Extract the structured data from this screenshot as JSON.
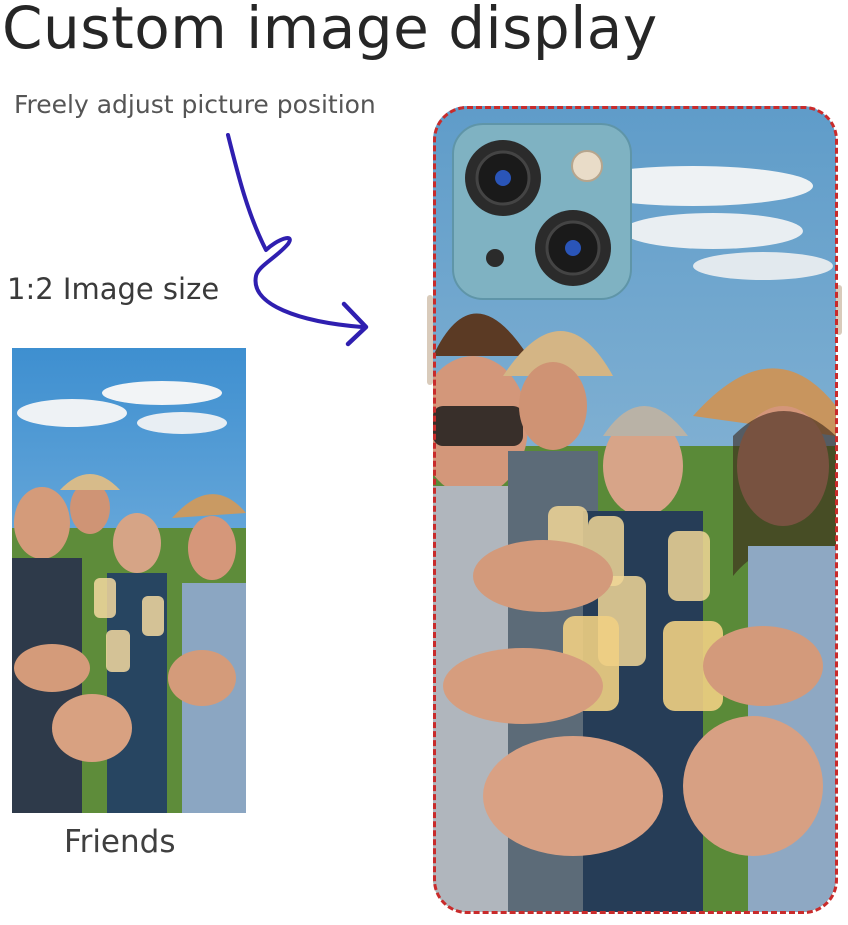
{
  "header": {
    "title": "Custom image display",
    "subtitle": "Freely adjust picture position"
  },
  "image_size_label": "1:2 Image size",
  "thumbnail": {
    "caption": "Friends"
  },
  "colors": {
    "arrow": "#2f1fb0",
    "dashed_border": "#c92b2b",
    "sky": "#6fa8d6",
    "grass": "#5e8c3a"
  },
  "icons": {
    "arrow": "curved-arrow-icon",
    "camera": "camera-module-icon"
  }
}
